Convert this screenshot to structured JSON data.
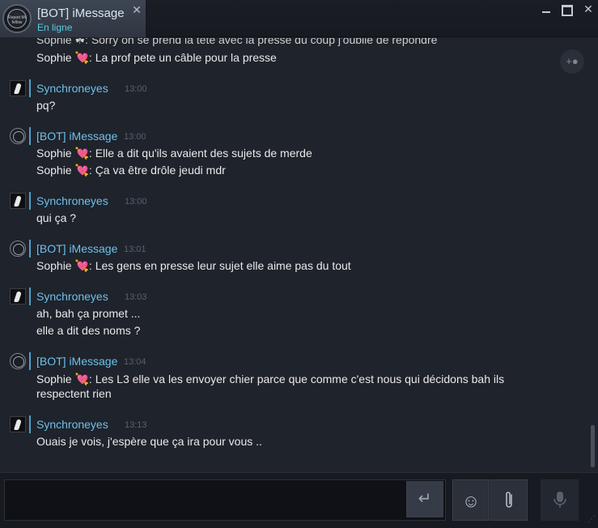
{
  "window": {
    "tab_name": "[BOT] iMessage",
    "tab_status": "En ligne",
    "tab_close": "✕",
    "tab_avatar_text": "Report Mi fellow"
  },
  "chat": {
    "partial_top": "Sophie ☘: Sorry on se prend la tête avec la presse du coup j'oublie de répondre",
    "line_top2": "Sophie 💘: La prof pete un câble pour la presse",
    "groups": [
      {
        "name": "Synchroneyes",
        "time": "13:00",
        "lines": [
          "pq?"
        ]
      },
      {
        "name": "[BOT] iMessage",
        "time": "13:00",
        "lines": [
          "Sophie 💘: Elle a dit qu'ils avaient des sujets de merde",
          "Sophie 💘: Ça va être drôle jeudi mdr"
        ]
      },
      {
        "name": "Synchroneyes",
        "time": "13:00",
        "lines": [
          "qui ça ?"
        ]
      },
      {
        "name": "[BOT] iMessage",
        "time": "13:01",
        "lines": [
          "Sophie 💘: Les gens en presse leur sujet elle aime pas du tout"
        ]
      },
      {
        "name": "Synchroneyes",
        "time": "13:03",
        "lines": [
          "ah, bah ça promet ...",
          "elle a dit des noms ?"
        ]
      },
      {
        "name": "[BOT] iMessage",
        "time": "13:04",
        "lines": [
          "Sophie 💘: Les L3 elle va les envoyer chier parce que comme c'est nous qui décidons bah ils respectent rien"
        ]
      },
      {
        "name": "Synchroneyes",
        "time": "13:13",
        "lines": [
          "Ouais je vois, j'espère que ça ira pour vous .."
        ]
      }
    ]
  },
  "compose": {
    "input_value": "",
    "enter_icon": "↵",
    "emoji_icon": "☺",
    "attach_icon": "⊂",
    "voice_icon": "🎙"
  },
  "icons": {
    "add_friend": "add-friend-icon",
    "minimize": "minimize-icon",
    "maximize": "maximize-icon",
    "close": "close-icon"
  },
  "colors": {
    "name_blue": "#6dc0ea",
    "status_cyan": "#57cbde",
    "background": "#1f232b"
  }
}
